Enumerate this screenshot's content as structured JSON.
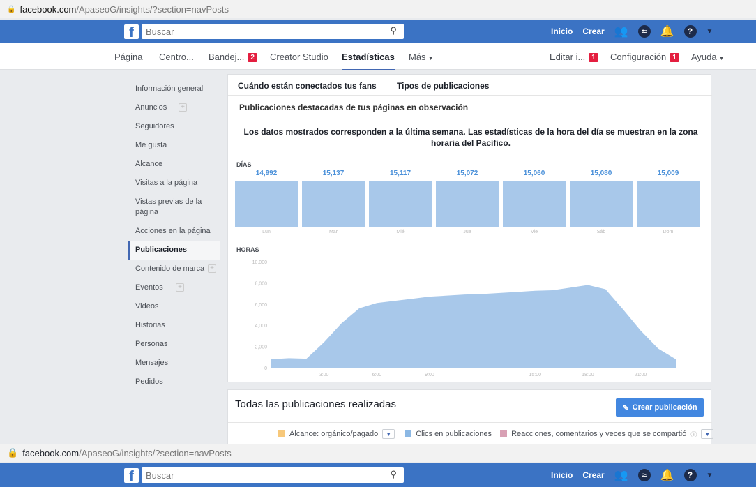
{
  "url": {
    "host": "facebook.com",
    "path": "/ApaseoG/insights/?section=navPosts"
  },
  "topbar": {
    "search_placeholder": "Buscar",
    "inicio": "Inicio",
    "crear": "Crear",
    "help_icon": "?"
  },
  "subnav": {
    "pagina": "Página",
    "centro": "Centro...",
    "bandeja": "Bandej...",
    "bandeja_badge": "2",
    "creator": "Creator Studio",
    "estadisticas": "Estadísticas",
    "mas": "Más",
    "editar": "Editar i...",
    "editar_badge": "1",
    "configuracion": "Configuración",
    "configuracion_badge": "1",
    "ayuda": "Ayuda"
  },
  "sidebar": {
    "items": [
      {
        "label": "Información general"
      },
      {
        "label": "Anuncios"
      },
      {
        "label": "Seguidores"
      },
      {
        "label": "Me gusta"
      },
      {
        "label": "Alcance"
      },
      {
        "label": "Visitas a la página"
      },
      {
        "label": "Vistas previas de la página"
      },
      {
        "label": "Acciones en la página"
      },
      {
        "label": "Publicaciones"
      },
      {
        "label": "Contenido de marca"
      },
      {
        "label": "Eventos"
      },
      {
        "label": "Videos"
      },
      {
        "label": "Historias"
      },
      {
        "label": "Personas"
      },
      {
        "label": "Mensajes"
      },
      {
        "label": "Pedidos"
      }
    ]
  },
  "content": {
    "tab_fans": "Cuándo están conectados tus fans",
    "tab_tipos": "Tipos de publicaciones",
    "subheading": "Publicaciones destacadas de tus páginas en observación",
    "note": "Los datos mostrados corresponden a la última semana. Las estadísticas de la hora del día se muestran en la zona horaria del Pacífico.",
    "days_label": "DÍAS",
    "hours_label": "HORAS"
  },
  "chart_data": [
    {
      "type": "bar",
      "title": "DÍAS",
      "categories": [
        "Lun",
        "Mar",
        "Mié",
        "Jue",
        "Vie",
        "Sáb",
        "Dom"
      ],
      "values": [
        14992,
        15137,
        15117,
        15072,
        15060,
        15080,
        15009
      ],
      "value_labels": [
        "14,992",
        "15,137",
        "15,117",
        "15,072",
        "15,060",
        "15,080",
        "15,009"
      ]
    },
    {
      "type": "area",
      "title": "HORAS",
      "x": [
        0,
        1,
        2,
        3,
        4,
        5,
        6,
        7,
        8,
        9,
        10,
        11,
        12,
        13,
        14,
        15,
        16,
        17,
        18,
        19,
        20,
        21,
        22,
        23
      ],
      "values": [
        800,
        900,
        850,
        2400,
        4200,
        5600,
        6100,
        6300,
        6500,
        6700,
        6800,
        6900,
        6950,
        7050,
        7150,
        7250,
        7300,
        7550,
        7800,
        7400,
        5500,
        3500,
        1800,
        800
      ],
      "ylim": [
        0,
        10000
      ],
      "yticks": [
        "0",
        "2,000",
        "4,000",
        "6,000",
        "8,000",
        "10,000"
      ],
      "xticks": [
        {
          "x": 3,
          "label": "3:00"
        },
        {
          "x": 6,
          "label": "6:00"
        },
        {
          "x": 9,
          "label": "9:00"
        },
        {
          "x": 15,
          "label": "15:00"
        },
        {
          "x": 18,
          "label": "18:00"
        },
        {
          "x": 21,
          "label": "21:00"
        }
      ],
      "color": "#a8c8ea"
    }
  ],
  "bottom": {
    "title": "Todas las publicaciones realizadas",
    "button": "Crear publicación",
    "legend": [
      {
        "label": "Alcance: orgánico/pagado",
        "color": "#f7c87a"
      },
      {
        "label": "Clics en publicaciones",
        "color": "#8cb8e4"
      },
      {
        "label": "Reacciones, comentarios y veces que se compartió",
        "color": "#d8a0b4"
      }
    ]
  },
  "colors": {
    "brand": "#3b73c4",
    "accent": "#4287e0",
    "badge": "#e41e3f",
    "bar": "#a8c8ea"
  }
}
